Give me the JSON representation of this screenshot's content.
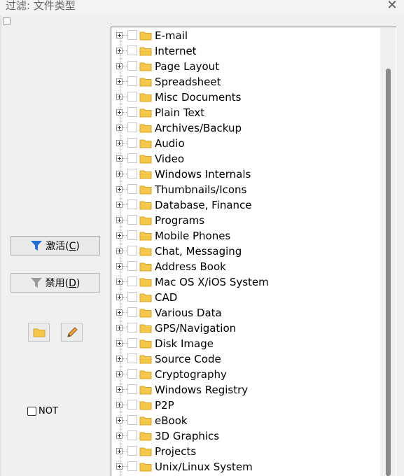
{
  "window": {
    "title": "过滤: 文件类型",
    "close_glyph": "✕"
  },
  "buttons": {
    "activate": {
      "text": "激活(",
      "key": "C",
      "end": ")"
    },
    "disable": {
      "text": "禁用(",
      "key": "D",
      "end": ")"
    }
  },
  "not_label": "NOT",
  "colors": {
    "folder": "#f5c84c",
    "filter_active": "#1e6fd6",
    "filter_disabled": "#9a9a9a",
    "scroll_thumb": "#8a8a8a"
  },
  "tree": {
    "items": [
      {
        "label": "E-mail"
      },
      {
        "label": "Internet"
      },
      {
        "label": "Page Layout"
      },
      {
        "label": "Spreadsheet"
      },
      {
        "label": "Misc Documents"
      },
      {
        "label": "Plain Text"
      },
      {
        "label": "Archives/Backup"
      },
      {
        "label": "Audio"
      },
      {
        "label": "Video"
      },
      {
        "label": "Windows Internals"
      },
      {
        "label": "Thumbnails/Icons"
      },
      {
        "label": "Database, Finance"
      },
      {
        "label": "Programs"
      },
      {
        "label": "Mobile Phones"
      },
      {
        "label": "Chat, Messaging"
      },
      {
        "label": "Address Book"
      },
      {
        "label": "Mac OS X/iOS System"
      },
      {
        "label": "CAD"
      },
      {
        "label": "Various Data"
      },
      {
        "label": "GPS/Navigation"
      },
      {
        "label": "Disk Image"
      },
      {
        "label": "Source Code"
      },
      {
        "label": "Cryptography"
      },
      {
        "label": "Windows Registry"
      },
      {
        "label": "P2P"
      },
      {
        "label": "eBook"
      },
      {
        "label": "3D Graphics"
      },
      {
        "label": "Projects"
      },
      {
        "label": "Unix/Linux System"
      }
    ]
  }
}
